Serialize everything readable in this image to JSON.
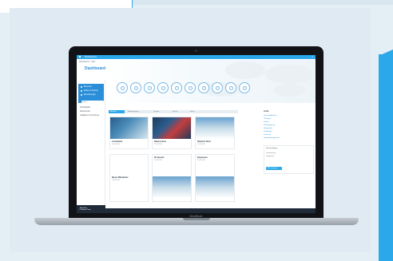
{
  "app": {
    "topbar_title": "Dashboard",
    "close_label": "×",
    "menu_icon": "hamburger-icon"
  },
  "header": {
    "breadcrumb": "Dashboard > Start",
    "page_title": "Dashboard"
  },
  "sidebar": {
    "section_items": [
      {
        "label": "Benutzer"
      },
      {
        "label": "Rollen & Rechte"
      },
      {
        "label": "Einstellungen"
      }
    ],
    "search_placeholder": "Suche...",
    "links": [
      {
        "label": "Arbeitsplatz"
      },
      {
        "label": "Dokumente"
      },
      {
        "label": "Aufgaben & Prozesse"
      }
    ],
    "footer_label": "Abmelden"
  },
  "tiles": [
    {
      "icon": "calendar-icon"
    },
    {
      "icon": "clock-icon"
    },
    {
      "icon": "document-icon"
    },
    {
      "icon": "chart-icon"
    },
    {
      "icon": "user-icon"
    },
    {
      "icon": "settings-icon"
    },
    {
      "icon": "mail-icon"
    },
    {
      "icon": "folder-icon"
    },
    {
      "icon": "search-icon"
    },
    {
      "icon": "help-icon"
    }
  ],
  "tabs": [
    {
      "label": "Aktuelles"
    },
    {
      "label": "Ankündigungen"
    },
    {
      "label": "Termine"
    },
    {
      "label": "Wissen"
    },
    {
      "label": "Archiv"
    }
  ],
  "cards": [
    {
      "title": "Architektur",
      "sub": "22.08.2024"
    },
    {
      "title": "Datenschutz",
      "sub": "21.08.2024"
    },
    {
      "title": "Standort Nord",
      "sub": "19.08.2024"
    },
    {
      "title": "Neuer Mitarbeiter",
      "sub": "15.08.2024"
    },
    {
      "title": "Firmensitz",
      "sub": "12.08.2024"
    },
    {
      "title": "Expansion",
      "sub": "10.08.2024"
    }
  ],
  "right_panel": {
    "title": "Links",
    "links": [
      {
        "label": "Personalabteilung"
      },
      {
        "label": "IT-Support"
      },
      {
        "label": "Kantine"
      },
      {
        "label": "Urlaubsplanung"
      },
      {
        "label": "Reisekosten"
      },
      {
        "label": "Schulungen"
      },
      {
        "label": "Formulare"
      },
      {
        "label": "Qualitätsmanagement"
      }
    ],
    "box_title": "Veranstaltungen",
    "box_rows": [
      {
        "text": "Teammeeting"
      },
      {
        "text": "Projektstart"
      }
    ],
    "button_label": "Alle anzeigen"
  },
  "footer": {
    "label": "© Intranet Portal"
  },
  "brand": "MacBook",
  "colors": {
    "accent": "#2aa8ea",
    "dark": "#1f2b38",
    "laptop": "#121317"
  }
}
